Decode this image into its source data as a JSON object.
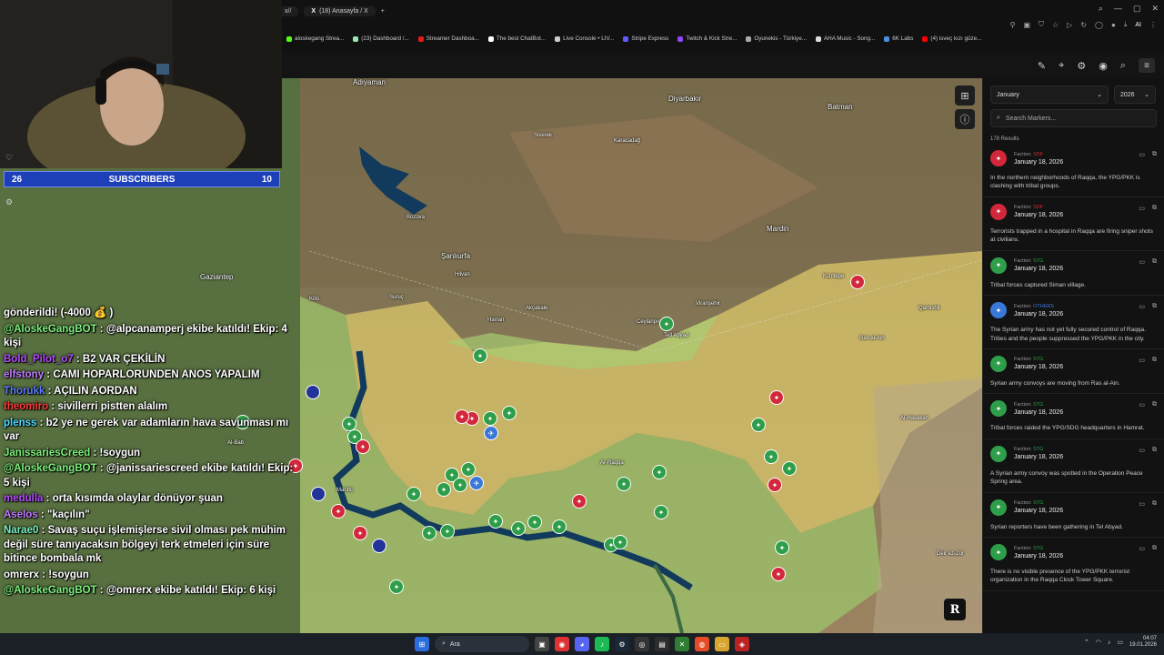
{
  "browser": {
    "tabs": [
      {
        "label": "x//",
        "active": false
      },
      {
        "label": "(18) Anasayfa / X",
        "active": true
      },
      {
        "label": "+",
        "active": false
      }
    ],
    "toolbar_ai": "AI",
    "bookmarks": [
      {
        "label": "aloskegang Strea...",
        "color": "#53fc18"
      },
      {
        "label": "(23) Dashboard /...",
        "color": "#9ae6b4"
      },
      {
        "label": "Streamer Dashboa...",
        "color": "#e91916"
      },
      {
        "label": "The best ChatBot...",
        "color": "#ffffff"
      },
      {
        "label": "Live Console • LIV...",
        "color": "#cccccc"
      },
      {
        "label": "Stripe Express",
        "color": "#635bff"
      },
      {
        "label": "Twitch & Kick Stre...",
        "color": "#9146ff"
      },
      {
        "label": "Oyunekis - Türkiye...",
        "color": "#aaaaaa"
      },
      {
        "label": "AHA Music - Song...",
        "color": "#dddddd"
      },
      {
        "label": "6K Labs",
        "color": "#4a90e2"
      },
      {
        "label": "(4) isveç kızı güze...",
        "color": "#ff0000"
      }
    ]
  },
  "stream": {
    "subscribers": {
      "left": "26",
      "label": "SUBSCRIBERS",
      "right": "10"
    },
    "chat": [
      {
        "user": "",
        "color": "#ffffff",
        "text": "gönderildi! (-4000 💰 )"
      },
      {
        "user": "@AloskeGangBOT",
        "color": "#7cf07c",
        "text": " : @alpcanamperj ekibe katıldı! Ekip: 4 kişi"
      },
      {
        "user": "Bold_Pilot_o7",
        "color": "#b44cff",
        "text": " : B2 VAR ÇEKİLİN"
      },
      {
        "user": "elfstony",
        "color": "#c27cff",
        "text": " : CAMI HOPARLORUNDEN ANOS YAPALIM"
      },
      {
        "user": "Thorukk",
        "color": "#5a7cff",
        "text": " : AÇILIN AORDAN"
      },
      {
        "user": "theomiro",
        "color": "#ff3a3a",
        "text": " : sivillerri pistten alalım"
      },
      {
        "user": "plenss",
        "color": "#4cd9ff",
        "text": " : b2 ye ne gerek var adamların hava savunması mı var"
      },
      {
        "user": "JanissariesCreed",
        "color": "#7cf07c",
        "text": " : !soygun"
      },
      {
        "user": "@AloskeGangBOT",
        "color": "#7cf07c",
        "text": " : @janissariescreed ekibe katıldı! Ekip: 5 kişi"
      },
      {
        "user": "medulla",
        "color": "#b44cff",
        "text": " : orta kısımda olaylar dönüyor şuan"
      },
      {
        "user": "Aselos",
        "color": "#c27cff",
        "text": " : \"kaçılın\""
      },
      {
        "user": "Narae0",
        "color": "#7cf0c0",
        "text": " : Savaş suçu işlemişlerse sivil olması pek mühim değil süre tanıyacaksın bölgeyi terk etmeleri için süre bitince bombala mk"
      },
      {
        "user": "omrerx",
        "color": "#ffffff",
        "text": " : !soygun"
      },
      {
        "user": "@AloskeGangBOT",
        "color": "#7cf07c",
        "text": " : @omrerx ekibe katıldı! Ekip: 6 kişi"
      }
    ]
  },
  "map": {
    "labels": [
      {
        "text": "Adıyaman",
        "cls": ""
      },
      {
        "text": "Diyarbakır",
        "cls": ""
      },
      {
        "text": "Batman",
        "cls": ""
      },
      {
        "text": "Gaziantep",
        "cls": ""
      },
      {
        "text": "Şanlıurfa",
        "cls": ""
      },
      {
        "text": "Mardin",
        "cls": ""
      },
      {
        "text": "Kilis",
        "cls": "small"
      },
      {
        "text": "Suruç",
        "cls": "small"
      },
      {
        "text": "Harran",
        "cls": "small"
      },
      {
        "text": "Akçakale",
        "cls": "small"
      },
      {
        "text": "Ceylanpınar",
        "cls": "small"
      },
      {
        "text": "Viranşehir",
        "cls": "small"
      },
      {
        "text": "Kızıltepe",
        "cls": "small"
      },
      {
        "text": "Siverek",
        "cls": "small"
      },
      {
        "text": "Karacadağ",
        "cls": "small"
      },
      {
        "text": "Bozova",
        "cls": "small"
      },
      {
        "text": "Hilvan",
        "cls": "small"
      },
      {
        "text": "Tell Abyad",
        "cls": "small"
      },
      {
        "text": "Ras al-Ain",
        "cls": "small"
      },
      {
        "text": "Al-Hasakah",
        "cls": "small"
      },
      {
        "text": "Ar-Raqqa",
        "cls": "small"
      },
      {
        "text": "Manbij",
        "cls": "small"
      },
      {
        "text": "Al-Bab",
        "cls": "small"
      },
      {
        "text": "Aleppo",
        "cls": "small"
      },
      {
        "text": "Qamishli",
        "cls": "small"
      },
      {
        "text": "Deir ez-Zor",
        "cls": "small"
      }
    ],
    "markers": [
      {
        "color": "green",
        "icon": "✦"
      },
      {
        "color": "green",
        "icon": "✦"
      },
      {
        "color": "green",
        "icon": "✦"
      },
      {
        "color": "green",
        "icon": "✦"
      },
      {
        "color": "green",
        "icon": "✦"
      },
      {
        "color": "green",
        "icon": "✦"
      },
      {
        "color": "green",
        "icon": "✦"
      },
      {
        "color": "green",
        "icon": "✦"
      },
      {
        "color": "green",
        "icon": "✦"
      },
      {
        "color": "green",
        "icon": "✦"
      },
      {
        "color": "green",
        "icon": "✦"
      },
      {
        "color": "green",
        "icon": "✦"
      },
      {
        "color": "green",
        "icon": "✦"
      },
      {
        "color": "green",
        "icon": "✦"
      },
      {
        "color": "green",
        "icon": "✦"
      },
      {
        "color": "green",
        "icon": "✦"
      },
      {
        "color": "green",
        "icon": "✦"
      },
      {
        "color": "green",
        "icon": "✦"
      },
      {
        "color": "green",
        "icon": "✦"
      },
      {
        "color": "green",
        "icon": "✦"
      },
      {
        "color": "green",
        "icon": "✦"
      },
      {
        "color": "green",
        "icon": "✦"
      },
      {
        "color": "green",
        "icon": "✦"
      },
      {
        "color": "green",
        "icon": "✦"
      },
      {
        "color": "green",
        "icon": "✦"
      },
      {
        "color": "green",
        "icon": "✦"
      },
      {
        "color": "green",
        "icon": "✦"
      },
      {
        "color": "green",
        "icon": "✦"
      },
      {
        "color": "red",
        "icon": "✦"
      },
      {
        "color": "red",
        "icon": "✦"
      },
      {
        "color": "red",
        "icon": "✦"
      },
      {
        "color": "red",
        "icon": "✦"
      },
      {
        "color": "red",
        "icon": "✦"
      },
      {
        "color": "red",
        "icon": "✦"
      },
      {
        "color": "red",
        "icon": "✦"
      },
      {
        "color": "red",
        "icon": "✦"
      },
      {
        "color": "red",
        "icon": "✦"
      },
      {
        "color": "red",
        "icon": "✦"
      },
      {
        "color": "red",
        "icon": "✦"
      },
      {
        "color": "blue",
        "icon": "✈"
      },
      {
        "color": "blue",
        "icon": "✈"
      },
      {
        "color": "navy",
        "icon": ""
      },
      {
        "color": "navy",
        "icon": ""
      },
      {
        "color": "navy",
        "icon": ""
      }
    ],
    "r_badge": "R"
  },
  "panel": {
    "month": "January",
    "year": "2026",
    "search_placeholder": "Search Markers...",
    "results": "178 Results",
    "faction_prefix": "Faction:",
    "events": [
      {
        "faction": "SDF",
        "color": "#d3283c",
        "date": "January 18, 2026",
        "text": "In the northern neighborhoods of Raqqa, the YPG/PKK is clashing with tribal groups."
      },
      {
        "faction": "SDF",
        "color": "#d3283c",
        "date": "January 18, 2026",
        "text": "Terrorists trapped in a hospital in Raqqa are firing sniper shots at civilians."
      },
      {
        "faction": "STG",
        "color": "#2e9e4a",
        "date": "January 18, 2026",
        "text": "Tribal forces captured Siman village."
      },
      {
        "faction": "OTHERS",
        "color": "#3a78d8",
        "date": "January 18, 2026",
        "text": "The Syrian army has not yet fully secured control of Raqqa. Tribes and the people suppressed the YPG/PKK in the city."
      },
      {
        "faction": "STG",
        "color": "#2e9e4a",
        "date": "January 18, 2026",
        "text": "Syrian army convoys are moving from Ras al-Ain."
      },
      {
        "faction": "STG",
        "color": "#2e9e4a",
        "date": "January 18, 2026",
        "text": "Tribal forces raided the YPG/SDG headquarters in Hamrat."
      },
      {
        "faction": "STG",
        "color": "#2e9e4a",
        "date": "January 18, 2026",
        "text": "A Syrian army convoy was spotted in the Operation Peace Spring area."
      },
      {
        "faction": "STG",
        "color": "#2e9e4a",
        "date": "January 18, 2026",
        "text": "Syrian reporters have been gathering in Tel Abyad."
      },
      {
        "faction": "STG",
        "color": "#2e9e4a",
        "date": "January 18, 2026",
        "text": "There is no visible presence of the YPG/PKK terrorist organization in the Raqqa Clock Tower Square."
      }
    ]
  },
  "taskbar": {
    "search": "Ara",
    "time": "04:07",
    "date": "19.01.2026"
  }
}
